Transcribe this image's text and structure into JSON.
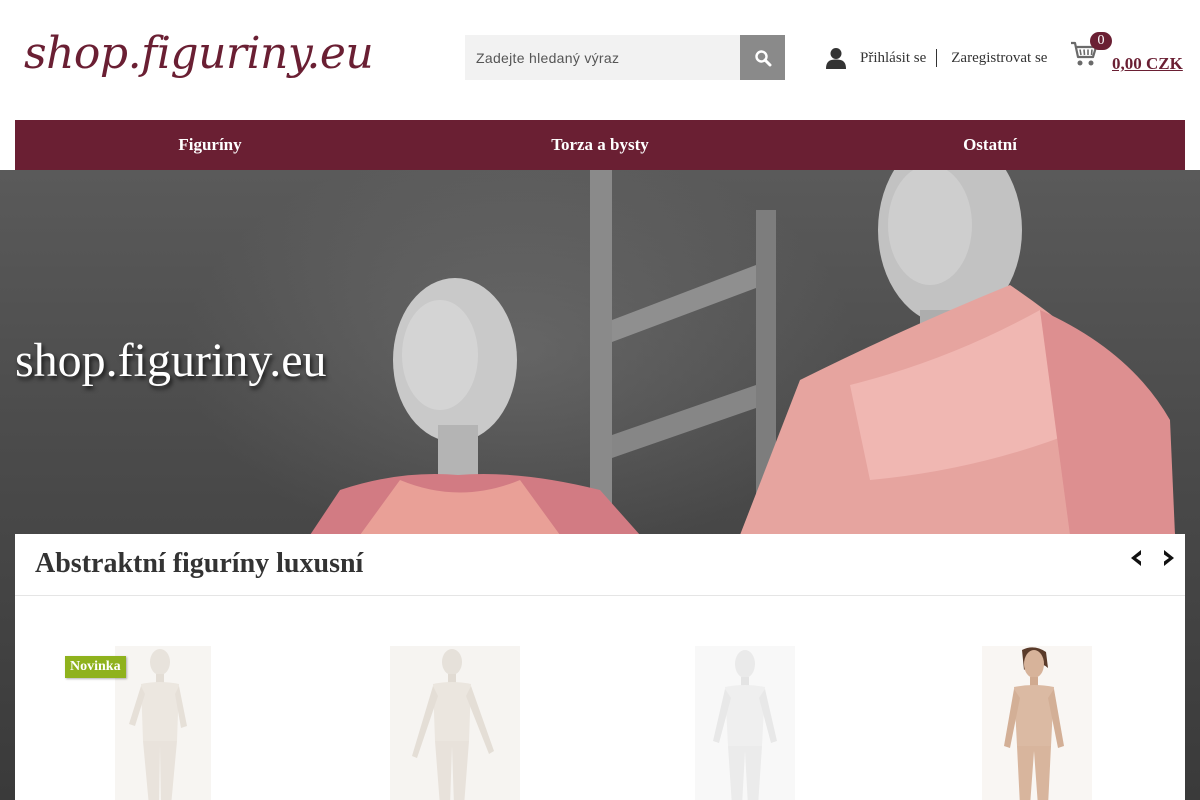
{
  "header": {
    "logo": "shop.figuriny.eu",
    "search": {
      "placeholder": "Zadejte hledaný výraz"
    },
    "login_label": "Přihlásit se",
    "register_label": "Zaregistrovat se",
    "cart": {
      "count": "0",
      "total": "0,00 CZK"
    }
  },
  "nav": {
    "items": [
      {
        "label": "Figuríny"
      },
      {
        "label": "Torza a bysty"
      },
      {
        "label": "Ostatní"
      }
    ]
  },
  "hero": {
    "title": "shop.figuriny.eu"
  },
  "products_section": {
    "title": "Abstraktní figuríny luxusní",
    "badge_new": "Novinka",
    "items": [
      {
        "image": "white-mannequin-1",
        "tone": "#efebe6"
      },
      {
        "image": "white-mannequin-2",
        "tone": "#efebe6"
      },
      {
        "image": "white-mannequin-3",
        "tone": "#f1f1f1"
      },
      {
        "image": "skin-tone-mannequin",
        "tone": "#d9b9a2"
      }
    ]
  },
  "colors": {
    "brand": "#6a1f33",
    "badge_green": "#8fb21d",
    "search_button": "#8a8a8a"
  }
}
